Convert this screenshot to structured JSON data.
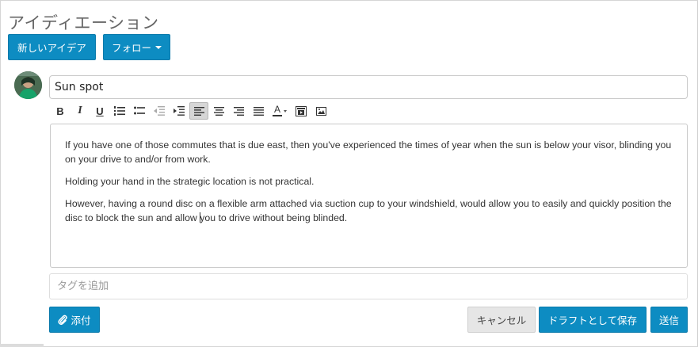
{
  "page": {
    "title": "アイディエーション"
  },
  "header_buttons": {
    "new_idea": "新しいアイデア",
    "follow": "フォロー"
  },
  "form": {
    "title_value": "Sun spot",
    "body_paragraphs": [
      "If you have one of those commutes that is due east, then you've experienced the times of year when the sun is below your visor, blinding you on your drive to and/or from work.",
      "Holding your hand in the strategic location is not practical.",
      "However, having a round disc on a flexible arm attached via suction cup to your windshield, would allow you to easily and quickly position the disc to block the sun and allow",
      "you to drive without being blinded."
    ],
    "tags_placeholder": "タグを追加"
  },
  "toolbar": {
    "bold": "B",
    "italic": "I",
    "underline": "U",
    "font_color": "A",
    "icons": [
      "bold-icon",
      "italic-icon",
      "underline-icon",
      "ordered-list-icon",
      "unordered-list-icon",
      "outdent-icon",
      "indent-icon",
      "align-left-icon",
      "align-center-icon",
      "align-right-icon",
      "justify-icon",
      "font-color-icon",
      "video-icon",
      "image-icon"
    ]
  },
  "actions": {
    "attach": "添付",
    "cancel": "キャンセル",
    "save_draft": "ドラフトとして保存",
    "send": "送信"
  },
  "colors": {
    "primary": "#0d8cc2",
    "cancel_bg": "#e6e6e6"
  }
}
